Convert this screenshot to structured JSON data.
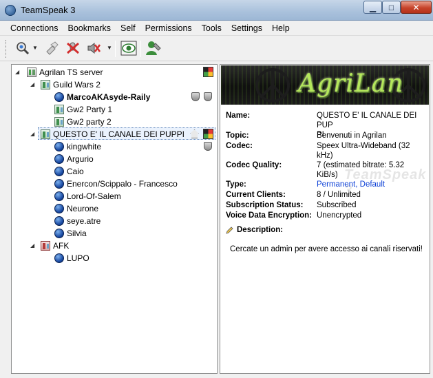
{
  "window": {
    "title": "TeamSpeak 3"
  },
  "menu": [
    "Connections",
    "Bookmarks",
    "Self",
    "Permissions",
    "Tools",
    "Settings",
    "Help"
  ],
  "toolbar": {
    "icons": [
      "connect-icon",
      "disconnect-icon",
      "mute-microphone-icon",
      "mute-speakers-icon",
      "away-icon",
      "avatar-icon"
    ]
  },
  "tree": {
    "server": "Agrilan TS server",
    "channels": [
      {
        "name": "Guild Wars 2",
        "children": [
          {
            "type": "user",
            "name": "MarcoAKAsyde-Raily"
          },
          {
            "type": "channel",
            "name": "Gw2 Party 1"
          },
          {
            "type": "channel",
            "name": "Gw2 party 2"
          }
        ]
      },
      {
        "name": "QUESTO E' IL CANALE DEI PUPPI",
        "children": [
          {
            "type": "user",
            "name": "kingwhite"
          },
          {
            "type": "user",
            "name": "Argurio"
          },
          {
            "type": "user",
            "name": "Caio"
          },
          {
            "type": "user",
            "name": "Enercon/Scippalo - Francesco"
          },
          {
            "type": "user",
            "name": "Lord-Of-Salem"
          },
          {
            "type": "user",
            "name": "Neurone"
          },
          {
            "type": "user",
            "name": "seye.atre"
          },
          {
            "type": "user",
            "name": "Silvia"
          }
        ]
      },
      {
        "name": "AFK",
        "children": [
          {
            "type": "user",
            "name": "LUPO"
          }
        ]
      }
    ]
  },
  "banner": {
    "text": "AgriLan"
  },
  "info": {
    "name_label": "Name:",
    "name_line1": "QUESTO E' IL CANALE DEI PUP",
    "name_line2": "PI",
    "topic_label": "Topic:",
    "topic": "Benvenuti in Agrilan",
    "codec_label": "Codec:",
    "codec_line1": "Speex Ultra-Wideband (32",
    "codec_line2": "kHz)",
    "quality_label": "Codec Quality:",
    "quality_line1": "7 (estimated bitrate: 5.32",
    "quality_line2": "KiB/s)",
    "type_label": "Type:",
    "type": "Permanent, Default",
    "clients_label": "Current Clients:",
    "clients": "8 / Unlimited",
    "subscription_label": "Subscription Status:",
    "subscription": "Subscribed",
    "encryption_label": "Voice Data Encryption:",
    "encryption": "Unencrypted",
    "description_label": "Description:",
    "description": "Cercate un admin per avere accesso ai canali riservati!",
    "watermark": "TeamSpeak 3"
  },
  "colors": {
    "link": "#0b3fd6",
    "banner_text": "#b4e85a"
  }
}
